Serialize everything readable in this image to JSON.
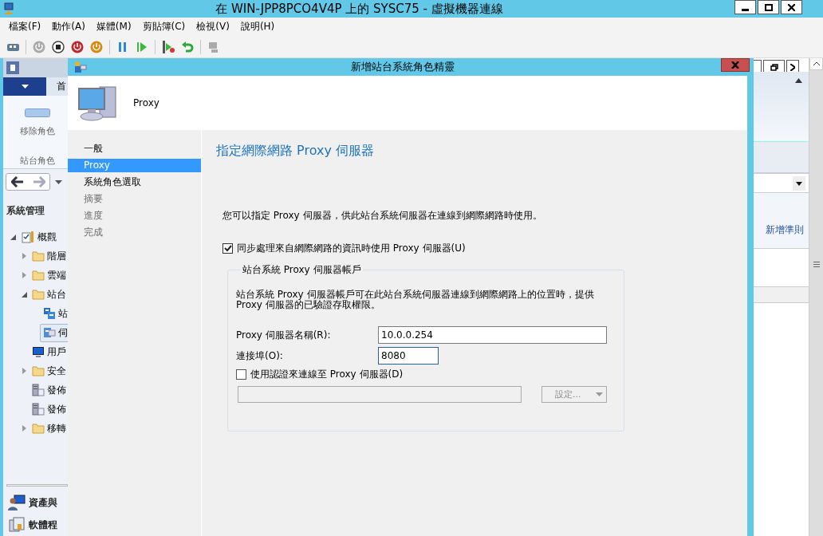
{
  "window": {
    "title": "在 WIN-JPP8PCO4V4P 上的 SYSC75 - 虛擬機器連線"
  },
  "menu": [
    "檔案(F)",
    "動作(A)",
    "媒體(M)",
    "剪貼簿(C)",
    "檢視(V)",
    "說明(H)"
  ],
  "toolbar": [
    {
      "kind": "ctrl-alt-del",
      "disabled": false
    },
    {
      "kind": "separator"
    },
    {
      "kind": "start",
      "disabled": true
    },
    {
      "kind": "turn-off",
      "disabled": false
    },
    {
      "kind": "shut-down",
      "disabled": false
    },
    {
      "kind": "save",
      "disabled": false
    },
    {
      "kind": "separator"
    },
    {
      "kind": "pause",
      "disabled": false
    },
    {
      "kind": "resume",
      "disabled": false
    },
    {
      "kind": "separator"
    },
    {
      "kind": "checkpoint",
      "disabled": false
    },
    {
      "kind": "revert",
      "disabled": false
    },
    {
      "kind": "separator"
    },
    {
      "kind": "enhanced",
      "disabled": true
    }
  ],
  "console": {
    "tab": "首",
    "ribbon": [
      "移除角色",
      "站台角色"
    ],
    "nav_title": "系統管理",
    "tree": [
      {
        "label": "概觀",
        "kind": "overview",
        "expanded": true,
        "selected": false,
        "children": [
          {
            "label": "階層",
            "kind": "folder",
            "expanded": false,
            "selected": false
          },
          {
            "label": "雲端",
            "kind": "folder",
            "expanded": false,
            "selected": false
          },
          {
            "label": "站台",
            "kind": "folder",
            "expanded": true,
            "selected": false,
            "children": [
              {
                "label": "站",
                "kind": "sites",
                "selected": false
              },
              {
                "label": "伺",
                "kind": "servers",
                "selected": true
              }
            ]
          },
          {
            "label": "用戶",
            "kind": "users",
            "selected": false
          },
          {
            "label": "安全",
            "kind": "folder",
            "expanded": false,
            "selected": false
          },
          {
            "label": "發佈",
            "kind": "publish",
            "selected": false
          },
          {
            "label": "發佈",
            "kind": "publish",
            "selected": false
          },
          {
            "label": "移轉",
            "kind": "folder",
            "expanded": false,
            "selected": false
          }
        ]
      }
    ],
    "workspaces": [
      {
        "label": "資產與",
        "kind": "assets"
      },
      {
        "label": "軟體程",
        "kind": "software"
      }
    ],
    "right_action": "新增準則"
  },
  "dialog": {
    "title": "新增站台系統角色精靈",
    "header": "Proxy",
    "steps": [
      {
        "label": "一般",
        "selected": false,
        "disabled": false
      },
      {
        "label": "Proxy",
        "selected": true,
        "disabled": false
      },
      {
        "label": "系統角色選取",
        "selected": false,
        "disabled": false
      },
      {
        "label": "摘要",
        "selected": false,
        "disabled": true
      },
      {
        "label": "進度",
        "selected": false,
        "disabled": true
      },
      {
        "label": "完成",
        "selected": false,
        "disabled": true
      }
    ],
    "heading": "指定網際網路 Proxy 伺服器",
    "description": "您可以指定 Proxy 伺服器，供此站台系統伺服器在連線到網際網路時使用。",
    "use_proxy": {
      "label": "同步處理來自網際網路的資訊時使用 Proxy 伺服器(U)",
      "checked": true
    },
    "group": {
      "legend": "站台系統 Proxy 伺服器帳戶",
      "text": "站台系統 Proxy 伺服器帳戶可在此站台系統伺服器連線到網際網路上的位置時，提供 Proxy 伺服器的已驗證存取權限。",
      "fields": [
        {
          "label": "Proxy 伺服器名稱(R):",
          "value": "10.0.0.254",
          "focused": false
        },
        {
          "label": "連接埠(O):",
          "value": "8080",
          "focused": true
        }
      ],
      "use_credentials": {
        "label": "使用認證來連線至 Proxy 伺服器(D)",
        "checked": false
      },
      "account": {
        "disabled": true
      },
      "set_button": {
        "label": "設定...",
        "disabled": true
      }
    }
  }
}
